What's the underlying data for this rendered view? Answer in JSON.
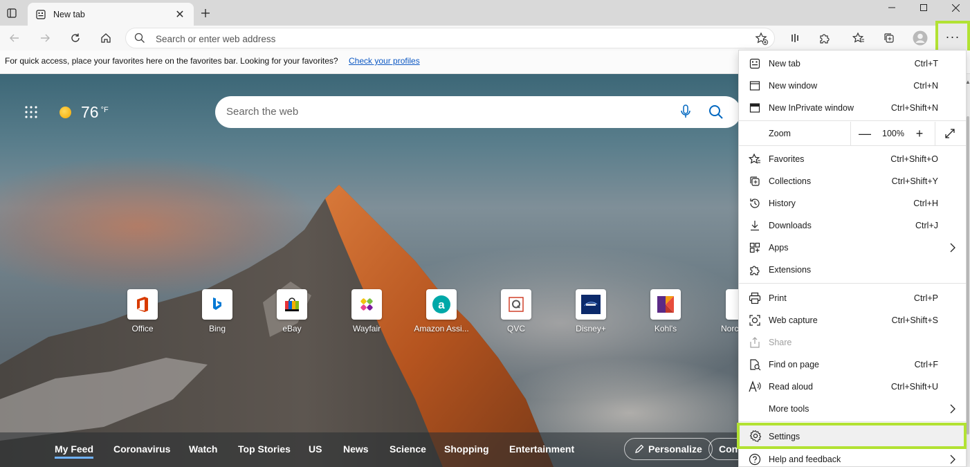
{
  "tab": {
    "title": "New tab",
    "close_label": "✕"
  },
  "newtab": {
    "label": "+"
  },
  "window_controls": {
    "minimize": "—",
    "maximize": "☐",
    "close": "✕"
  },
  "address_bar": {
    "placeholder": "Search or enter web address"
  },
  "favorites_bar": {
    "message": "For quick access, place your favorites here on the favorites bar. Looking for your favorites?",
    "link": "Check your profiles"
  },
  "more_button": {
    "label": "···"
  },
  "weather": {
    "temp": "76",
    "unit": "°F"
  },
  "web_search": {
    "placeholder": "Search the web"
  },
  "quick_links": [
    {
      "label": "Office",
      "color": "#d83b01"
    },
    {
      "label": "Bing",
      "color": "#0078d4"
    },
    {
      "label": "eBay",
      "color": "#e53238"
    },
    {
      "label": "Wayfair",
      "color": "#7b189f"
    },
    {
      "label": "Amazon Assi...",
      "color": "#00a8a8"
    },
    {
      "label": "QVC",
      "color": "#d0402a"
    },
    {
      "label": "Disney+",
      "color": "#0c2a6b"
    },
    {
      "label": "Kohl's",
      "color": "#5b2a86"
    },
    {
      "label": "Norc",
      "color": "#333333"
    }
  ],
  "feed_tabs": [
    "My Feed",
    "Coronavirus",
    "Watch",
    "Top Stories",
    "US",
    "News",
    "Science",
    "Shopping",
    "Entertainment"
  ],
  "personalize": {
    "label": "Personalize"
  },
  "content_btn": {
    "label": "Con"
  },
  "menu": {
    "items": [
      {
        "label": "New tab",
        "shortcut": "Ctrl+T"
      },
      {
        "label": "New window",
        "shortcut": "Ctrl+N"
      },
      {
        "label": "New InPrivate window",
        "shortcut": "Ctrl+Shift+N"
      },
      {
        "label": "Favorites",
        "shortcut": "Ctrl+Shift+O"
      },
      {
        "label": "Collections",
        "shortcut": "Ctrl+Shift+Y"
      },
      {
        "label": "History",
        "shortcut": "Ctrl+H"
      },
      {
        "label": "Downloads",
        "shortcut": "Ctrl+J"
      },
      {
        "label": "Apps",
        "shortcut": ""
      },
      {
        "label": "Extensions",
        "shortcut": ""
      },
      {
        "label": "Print",
        "shortcut": "Ctrl+P"
      },
      {
        "label": "Web capture",
        "shortcut": "Ctrl+Shift+S"
      },
      {
        "label": "Share",
        "shortcut": ""
      },
      {
        "label": "Find on page",
        "shortcut": "Ctrl+F"
      },
      {
        "label": "Read aloud",
        "shortcut": "Ctrl+Shift+U"
      },
      {
        "label": "More tools",
        "shortcut": ""
      },
      {
        "label": "Settings",
        "shortcut": ""
      },
      {
        "label": "Help and feedback",
        "shortcut": ""
      }
    ],
    "zoom": {
      "label": "Zoom",
      "value": "100%",
      "minus": "—",
      "plus": "+"
    }
  },
  "colors": {
    "highlight": "#b2e233",
    "link": "#0b57c3"
  }
}
